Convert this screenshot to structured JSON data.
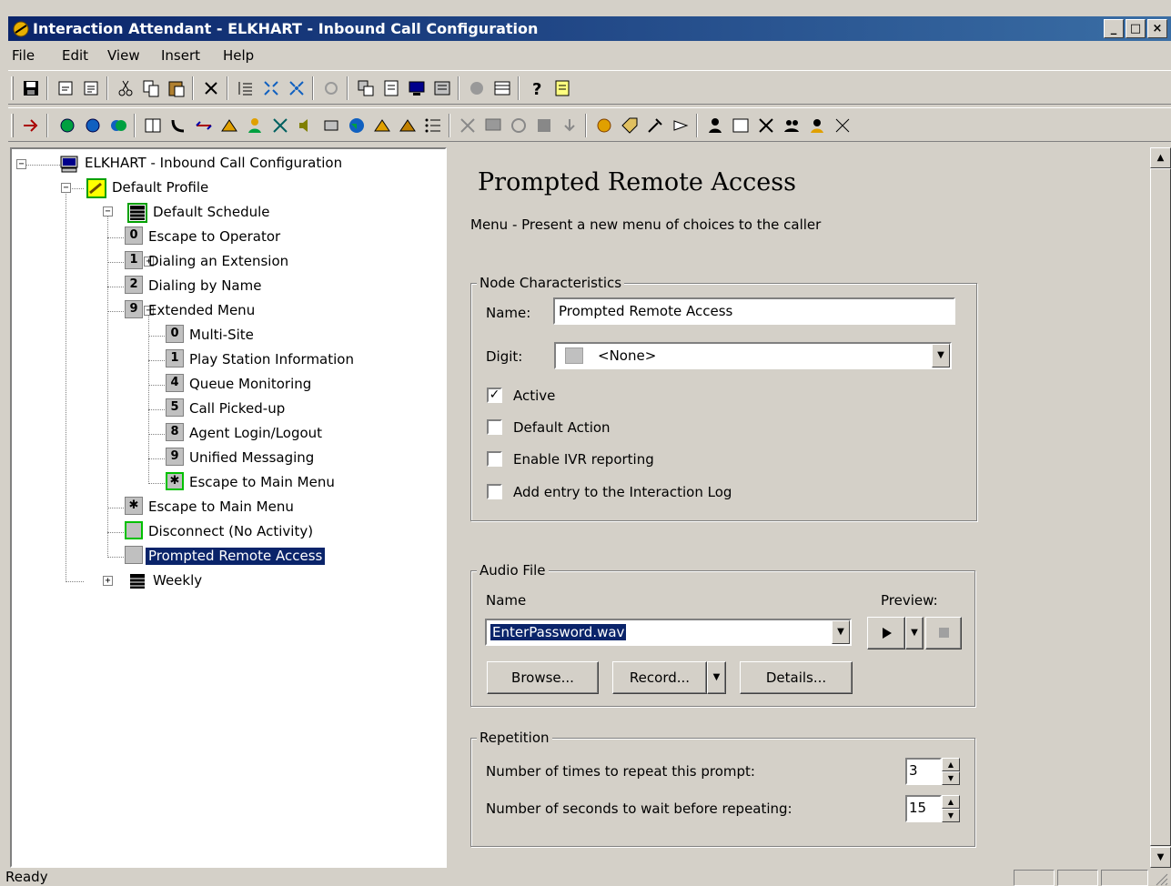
{
  "window": {
    "title": "Interaction Attendant - ELKHART - Inbound Call Configuration",
    "controls": [
      "_",
      "□",
      "×"
    ]
  },
  "menu": [
    "File",
    "Edit",
    "View",
    "Insert",
    "Help"
  ],
  "tree": {
    "root": "ELKHART - Inbound Call Configuration",
    "profile": "Default Profile",
    "schedule": "Default Schedule",
    "items": [
      {
        "digit": "0",
        "label": "Escape to Operator"
      },
      {
        "digit": "1",
        "label": "Dialing an Extension"
      },
      {
        "digit": "2",
        "label": "Dialing by Name"
      },
      {
        "digit": "9",
        "label": "Extended Menu"
      }
    ],
    "submenu": [
      {
        "digit": "0",
        "label": "Multi-Site"
      },
      {
        "digit": "1",
        "label": "Play Station Information"
      },
      {
        "digit": "4",
        "label": "Queue Monitoring"
      },
      {
        "digit": "5",
        "label": "Call Picked-up"
      },
      {
        "digit": "8",
        "label": "Agent Login/Logout"
      },
      {
        "digit": "9",
        "label": "Unified Messaging"
      },
      {
        "digit": "✱",
        "label": "Escape to Main Menu"
      }
    ],
    "after": [
      {
        "digit": "✱",
        "label": "Escape to Main Menu"
      },
      {
        "digit": "",
        "label": "Disconnect (No Activity)"
      },
      {
        "digit": "",
        "label": "Prompted Remote Access"
      }
    ],
    "weekly": "Weekly"
  },
  "detail": {
    "heading": "Prompted Remote Access",
    "subheading": "Menu - Present a new menu of choices to the caller",
    "node": {
      "legend": "Node Characteristics",
      "name_label": "Name:",
      "name_value": "Prompted Remote Access",
      "digit_label": "Digit:",
      "digit_value": "<None>",
      "checkboxes": [
        {
          "label": "Active",
          "checked": true
        },
        {
          "label": "Default Action",
          "checked": false
        },
        {
          "label": "Enable IVR reporting",
          "checked": false
        },
        {
          "label": "Add entry to the Interaction Log",
          "checked": false
        }
      ]
    },
    "audio": {
      "legend": "Audio File",
      "name_label": "Name",
      "preview_label": "Preview:",
      "file": "EnterPassword.wav",
      "browse": "Browse...",
      "record": "Record...",
      "details": "Details..."
    },
    "repetition": {
      "legend": "Repetition",
      "repeat_label": "Number of times to repeat this prompt:",
      "repeat_value": "3",
      "wait_label": "Number of seconds to wait before repeating:",
      "wait_value": "15"
    }
  },
  "status": {
    "text": "Ready"
  }
}
